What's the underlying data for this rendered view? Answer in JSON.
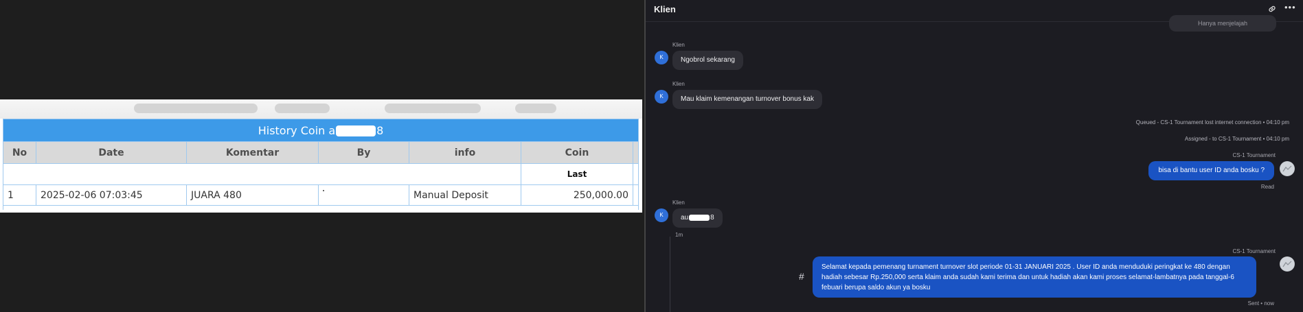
{
  "history": {
    "title_prefix": "History Coin a",
    "title_suffix": "8",
    "columns": [
      "No",
      "Date",
      "Komentar",
      "By",
      "info",
      "Coin"
    ],
    "sub_label": "Last",
    "rows": [
      {
        "no": "1",
        "date": "2025-02-06 07:03:45",
        "komentar": "JUARA 480",
        "by": "",
        "info": "Manual Deposit",
        "coin": "250,000.00"
      }
    ]
  },
  "chat": {
    "title": "Klien",
    "top_pill": "Hanya menjelajah",
    "sender_client": "Klien",
    "sender_agent": "CS-1 Tournament",
    "avatar_letter": "K",
    "messages": {
      "m1": "Ngobrol sekarang",
      "m2": "Mau klaim kemenangan turnover bonus kak",
      "sys1": "Queued - CS-1 Tournament lost internet connection • 04:10 pm",
      "sys2": "Assigned - to CS-1 Tournament • 04:10 pm",
      "m3": "bisa di bantu user ID anda bosku ?",
      "m3_status": "Read",
      "m4_prefix": "au",
      "m4_suffix": "8",
      "m4_time": "1m",
      "m5": "Selamat kepada pemenang turnament turnover slot periode 01-31 JANUARI 2025 . User ID anda menduduki peringkat ke 480 dengan hadiah sebesar Rp.250,000 serta klaim anda sudah kami terima dan untuk hadiah akan kami proses selamat-lambatnya pada tanggal-6 febuari berupa saldo akun ya bosku",
      "m5_status": "Sent • now"
    },
    "hash_label": "#",
    "icons": {
      "link": "link-icon",
      "more": "more-options-icon"
    }
  }
}
